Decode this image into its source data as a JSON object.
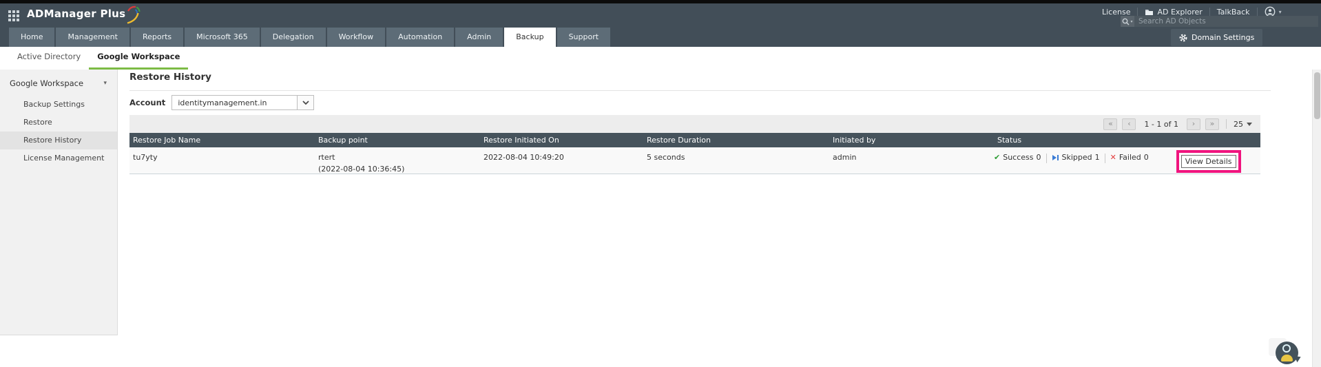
{
  "colors": {
    "header_bg": "#424e58",
    "tab_bg": "#5d6c77",
    "accent_green": "#7cbb45",
    "table_header_bg": "#46535c",
    "highlight_pink": "#f0147e",
    "success_green": "#2e9e35",
    "skipped_blue": "#3a7bd5",
    "failed_red": "#e23b3b"
  },
  "icons": {
    "caret_down": "▾",
    "success_glyph": "✔",
    "failed_glyph": "✕",
    "apps_grid": "3x3-dots",
    "folder": "folder",
    "user": "person-circle",
    "search": "magnifier",
    "gear": "gear",
    "skipped": "skip-to-end",
    "chat": "person-speech-bubble"
  },
  "header": {
    "logo_text": "ADManager Plus",
    "links": {
      "license": "License",
      "ad_explorer": "AD Explorer",
      "talkback": "TalkBack"
    },
    "search": {
      "placeholder": "Search AD Objects"
    },
    "domain_settings": "Domain Settings"
  },
  "nav": {
    "tabs": [
      {
        "label": "Home",
        "active": false
      },
      {
        "label": "Management",
        "active": false
      },
      {
        "label": "Reports",
        "active": false
      },
      {
        "label": "Microsoft 365",
        "active": false
      },
      {
        "label": "Delegation",
        "active": false
      },
      {
        "label": "Workflow",
        "active": false
      },
      {
        "label": "Automation",
        "active": false
      },
      {
        "label": "Admin",
        "active": false
      },
      {
        "label": "Backup",
        "active": true
      },
      {
        "label": "Support",
        "active": false
      }
    ],
    "subtabs": [
      {
        "label": "Active Directory",
        "active": false
      },
      {
        "label": "Google Workspace",
        "active": true
      }
    ]
  },
  "sidebar": {
    "header": "Google Workspace",
    "items": [
      {
        "label": "Backup Settings",
        "active": false
      },
      {
        "label": "Restore",
        "active": false
      },
      {
        "label": "Restore History",
        "active": true
      },
      {
        "label": "License Management",
        "active": false
      }
    ]
  },
  "main": {
    "title": "Restore History",
    "account": {
      "label": "Account",
      "value": "identitymanagement.in"
    },
    "pagination": {
      "first": "«",
      "prev": "‹",
      "range": "1 - 1 of 1",
      "next": "›",
      "last": "»",
      "page_size": "25"
    },
    "table": {
      "columns": [
        "Restore Job Name",
        "Backup point",
        "Restore Initiated On",
        "Restore Duration",
        "Initiated by",
        "Status"
      ],
      "row": {
        "job_name": "tu7yty",
        "backup_point": "rtert",
        "backup_point_time": "(2022-08-04 10:36:45)",
        "initiated_on": "2022-08-04 10:49:20",
        "duration": "5 seconds",
        "initiated_by": "admin",
        "status": [
          {
            "icon": "check",
            "label": "Success",
            "count": "0"
          },
          {
            "icon": "skip",
            "label": "Skipped",
            "count": "1"
          },
          {
            "icon": "cross",
            "label": "Failed",
            "count": "0"
          }
        ],
        "action": "View Details"
      }
    }
  }
}
